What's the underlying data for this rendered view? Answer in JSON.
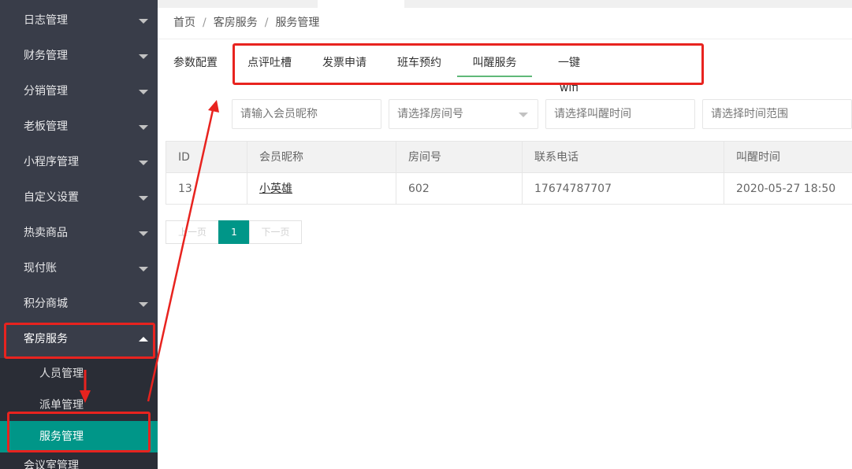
{
  "sidebar": {
    "items": [
      {
        "label": "日志管理"
      },
      {
        "label": "财务管理"
      },
      {
        "label": "分销管理"
      },
      {
        "label": "老板管理"
      },
      {
        "label": "小程序管理"
      },
      {
        "label": "自定义设置"
      },
      {
        "label": "热卖商品"
      },
      {
        "label": "现付账"
      },
      {
        "label": "积分商城"
      },
      {
        "label": "客房服务"
      }
    ],
    "subitems": [
      {
        "label": "人员管理"
      },
      {
        "label": "派单管理"
      },
      {
        "label": "服务管理"
      }
    ],
    "partial_item": {
      "label": "会议室管理"
    }
  },
  "breadcrumb": {
    "home": "首页",
    "section": "客房服务",
    "current": "服务管理",
    "separator": "/"
  },
  "tabs": [
    "参数配置",
    "点评吐槽",
    "发票申请",
    "班车预约",
    "叫醒服务",
    "一键wifi"
  ],
  "active_tab": "叫醒服务",
  "filters": {
    "nickname_placeholder": "请输入会员昵称",
    "room_placeholder": "请选择房间号",
    "wake_time_placeholder": "请选择叫醒时间",
    "range_placeholder": "请选择时间范围"
  },
  "table": {
    "headers": [
      "ID",
      "会员昵称",
      "房间号",
      "联系电话",
      "叫醒时间"
    ],
    "rows": [
      {
        "id": "13",
        "nickname": "小英雄",
        "room": "602",
        "phone": "17674787707",
        "wake_time": "2020-05-27 18:50"
      }
    ]
  },
  "pagination": {
    "prev": "上一页",
    "current": "1",
    "next": "下一页"
  },
  "colors": {
    "sidebar_bg": "#393d49",
    "active_green": "#009688",
    "tab_underline": "#5fb878",
    "annotation_red": "#e8231f"
  },
  "icons": {
    "sidebar_caret": "chevron-down-icon",
    "open_caret": "chevron-up-icon",
    "select_arrow": "chevron-down-icon"
  }
}
